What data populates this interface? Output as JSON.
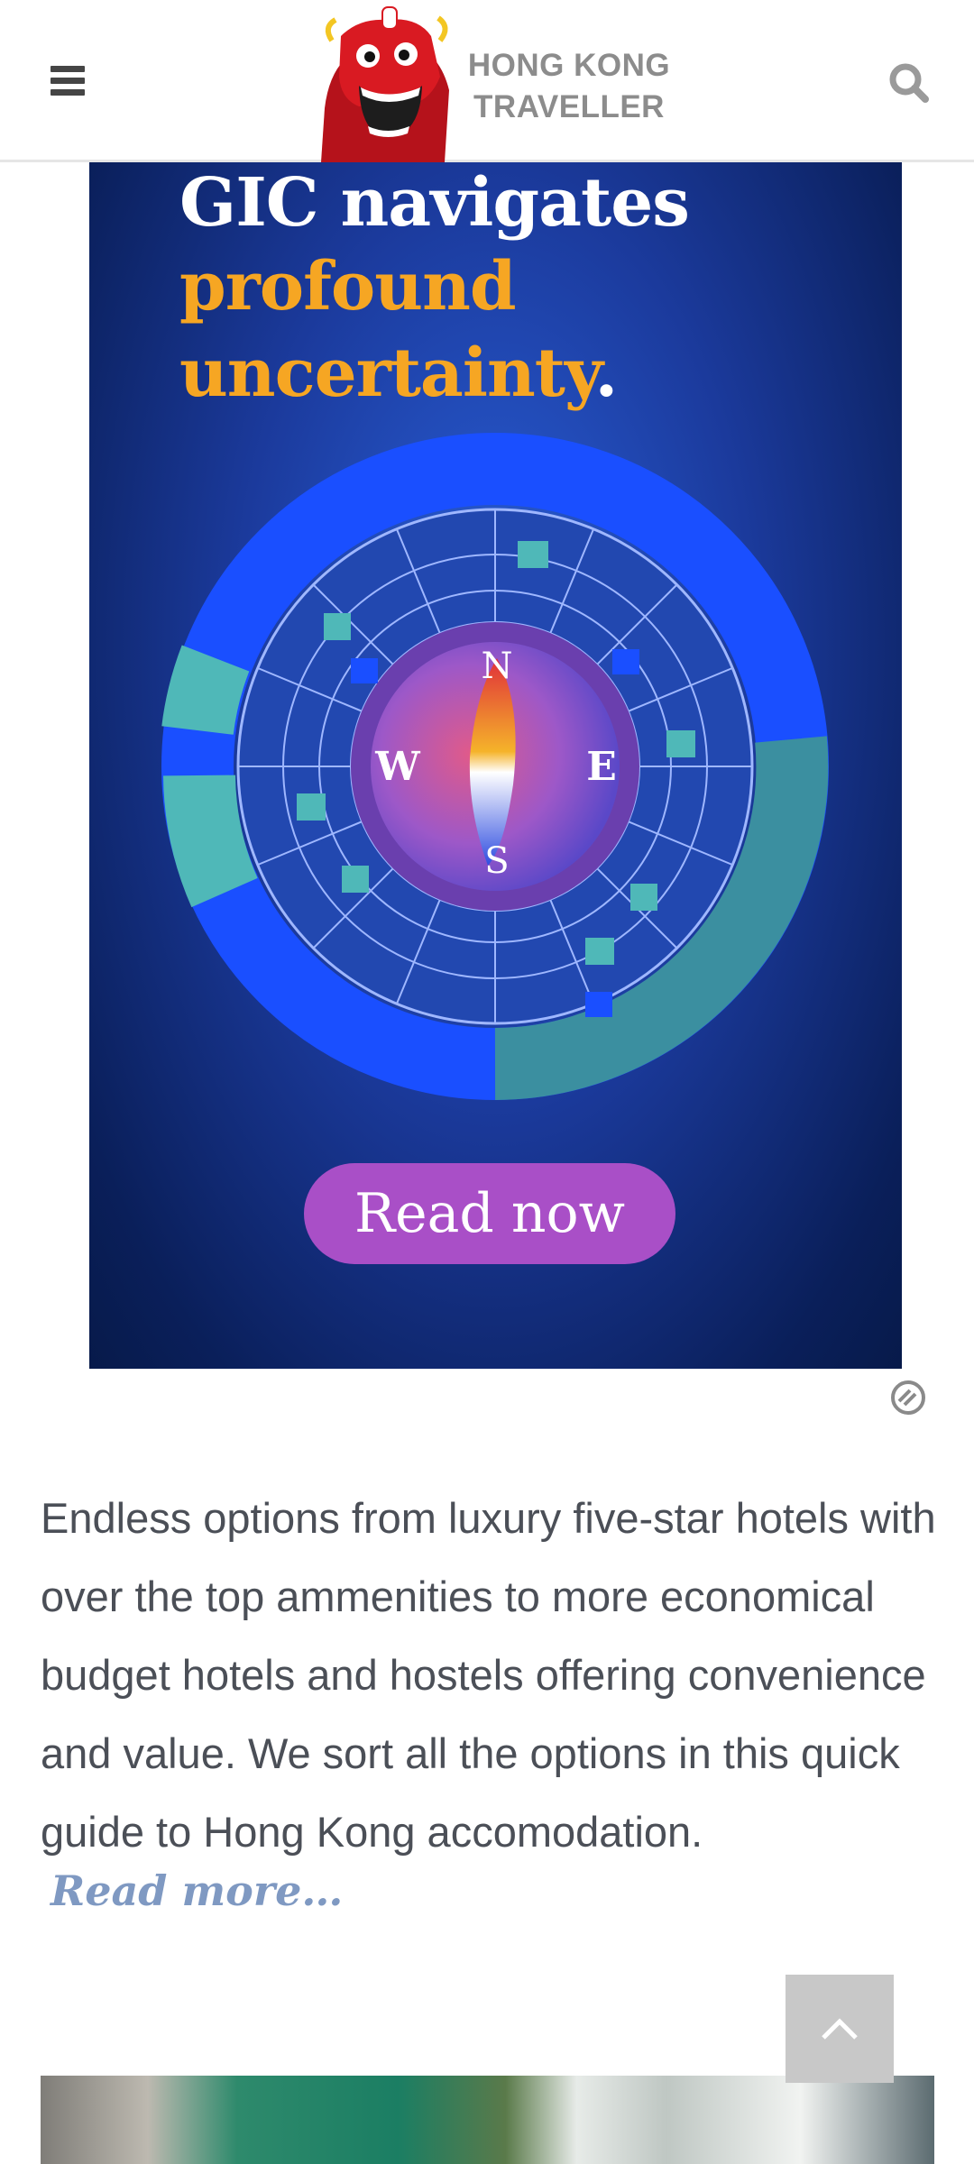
{
  "header": {
    "logo_line1": "HONG KONG",
    "logo_line2": "TRAVELLER",
    "menu_icon": "hamburger-menu-icon",
    "search_icon": "search-icon"
  },
  "ad": {
    "headline_line1": "GIC navigates",
    "headline_line2": "profound",
    "headline_line3": "uncertainty",
    "headline_period": ".",
    "compass_n": "N",
    "compass_e": "E",
    "compass_s": "S",
    "compass_w": "W",
    "cta_label": "Read now",
    "adchoices_icon": "adchoices-icon",
    "colors": {
      "background": "#1b3a9c",
      "accent": "#f6a623",
      "cta": "#a94fc7",
      "ring_blue": "#1a4fff",
      "ring_teal": "#4fb8b8"
    }
  },
  "article": {
    "excerpt": "Endless options from luxury five-star hotels with over the top ammenities to more economical budget hotels and hostels offering convenience and value. We sort all the options in this quick guide to Hong Kong accomodation.",
    "read_more": "Read more…"
  },
  "back_to_top_icon": "chevron-up-icon"
}
